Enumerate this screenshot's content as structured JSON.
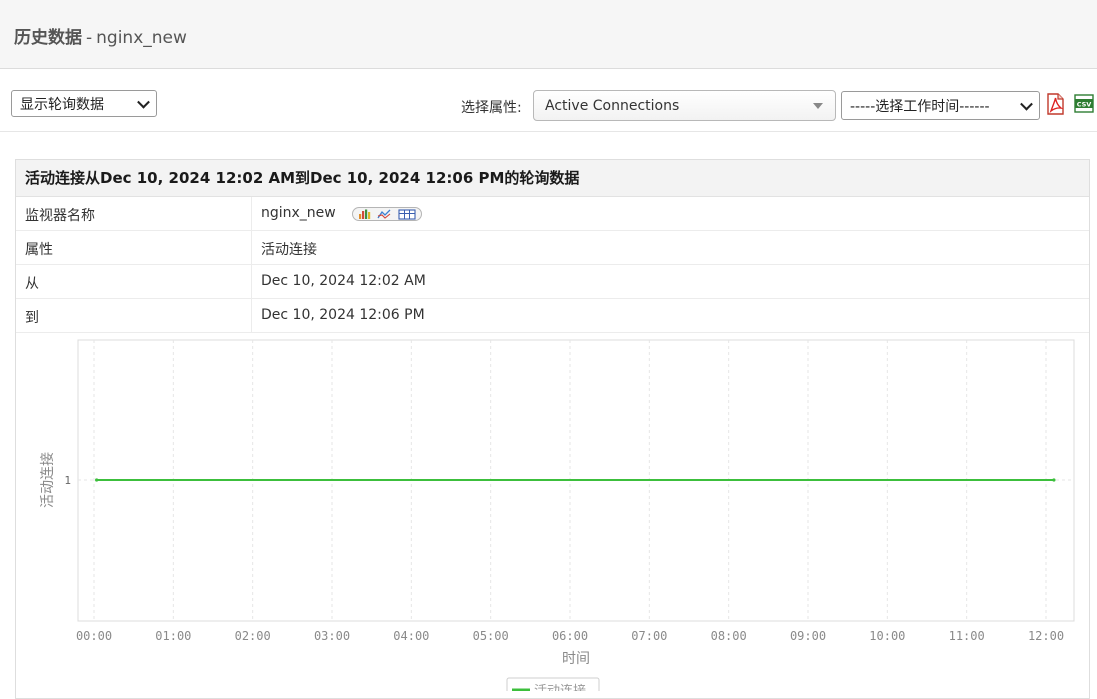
{
  "header": {
    "title_bold": "历史数据",
    "separator": "-",
    "monitor": "nginx_new"
  },
  "toolbar": {
    "view_select": "显示轮询数据",
    "attribute_label": "选择属性:",
    "attribute_select": "Active Connections",
    "worktime_select": "-----选择工作时间------",
    "pdf_icon": "pdf-export-icon",
    "csv_icon": "csv-export-icon"
  },
  "panel": {
    "heading": "活动连接从Dec 10, 2024 12:02 AM到Dec 10, 2024 12:06 PM的轮询数据",
    "rows": [
      {
        "key": "监视器名称",
        "value": "nginx_new"
      },
      {
        "key": "属性",
        "value": "活动连接"
      },
      {
        "key": "从",
        "value": "Dec 10, 2024 12:02 AM"
      },
      {
        "key": "到",
        "value": "Dec 10, 2024 12:06 PM"
      }
    ],
    "monitor_icons": [
      "bar-chart-icon",
      "line-chart-icon",
      "table-icon"
    ]
  },
  "colors": {
    "series": "#3cbf3c",
    "grid": "#e6e6e6",
    "axis_text": "#8a8a8a"
  },
  "chart_data": {
    "type": "line",
    "xlabel": "时间",
    "ylabel": "活动连接",
    "x_ticks": [
      "00:00",
      "01:00",
      "02:00",
      "03:00",
      "04:00",
      "05:00",
      "06:00",
      "07:00",
      "08:00",
      "09:00",
      "10:00",
      "11:00",
      "12:00"
    ],
    "y_ticks": [
      1
    ],
    "xlim": [
      "00:00",
      "12:10"
    ],
    "grid": true,
    "legend_position": "bottom",
    "series": [
      {
        "name": "活动连接",
        "x": [
          "00:02",
          "12:06"
        ],
        "y": [
          1,
          1
        ]
      }
    ]
  }
}
